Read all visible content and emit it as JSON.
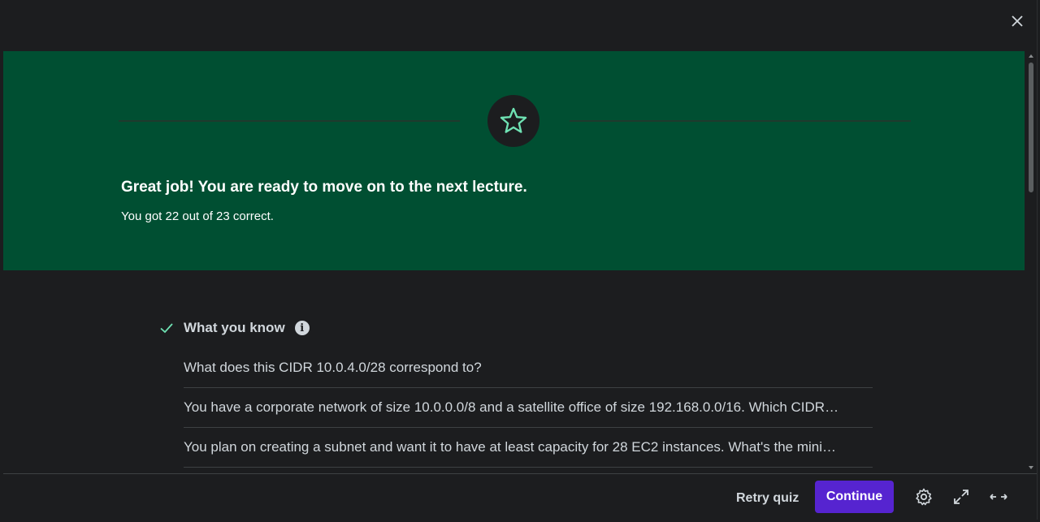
{
  "hero": {
    "title": "Great job! You are ready to move on to the next lecture.",
    "subtitle": "You got 22 out of 23 correct."
  },
  "know": {
    "title": "What you know",
    "info_glyph": "i",
    "questions": [
      "What does this CIDR 10.0.4.0/28 correspond to?",
      "You have a corporate network of size 10.0.0.0/8 and a satellite office of size 192.168.0.0/16. Which CIDR…",
      "You plan on creating a subnet and want it to have at least capacity for 28 EC2 instances. What's the mini…"
    ]
  },
  "footer": {
    "retry_label": "Retry quiz",
    "continue_label": "Continue"
  },
  "colors": {
    "hero_bg": "#004f32",
    "accent_green": "#6fe2b3",
    "primary_purple": "#5624d0",
    "page_bg": "#1c1d1f"
  },
  "icons": [
    "close-icon",
    "star-icon",
    "check-icon",
    "info-icon",
    "settings-icon",
    "expand-icon",
    "wide-view-icon"
  ]
}
